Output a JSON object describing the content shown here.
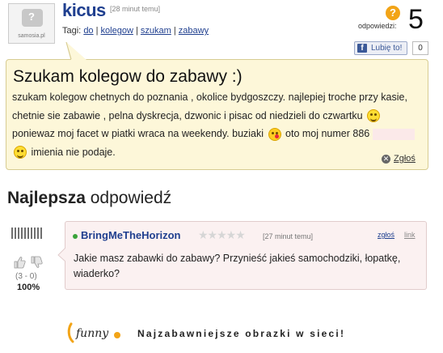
{
  "question": {
    "avatar_label": "samosia.pl",
    "username": "kicus",
    "time": "[28 minut temu]",
    "tags_label": "Tagi:",
    "tags": [
      "do",
      "kolegow",
      "szukam",
      "zabawy"
    ],
    "answers_label": "odpowiedzi:",
    "answers_count": "5",
    "like_label": "Lubię to!",
    "like_count": "0",
    "title": "Szukam kolegow do zabawy :)",
    "body_1": "szukam kolegow chetnych do poznania , okolice bydgoszczy. najlepiej troche przy kasie, chetnie sie zabawie , pelna dyskrecja, dzwonic i pisac od niedzieli do czwartku",
    "body_2": "poniewaz moj facet w piatki wraca na weekendy. buziaki",
    "body_3": "oto moj numer 886",
    "body_4": "imienia nie podaje.",
    "report_label": "Zgłoś"
  },
  "best_answer": {
    "heading_bold": "Najlepsza",
    "heading_rest": " odpowiedź",
    "username": "BringMeTheHorizon",
    "stars": "★★★★★",
    "time": "[27 minut temu]",
    "report_label": "zgłoś",
    "link_label": "link",
    "text": "Jakie masz zabawki do zabawy? Przynieść jakieś samochodziki, łopatkę, wiaderko?",
    "votes": "(3 - 0)",
    "percent": "100%"
  },
  "footer": {
    "logo_text": "funny",
    "slogan": "Najzabawniejsze obrazki w sieci!"
  },
  "colors": {
    "link_blue": "#1f3f8f",
    "question_bg": "#fdf7d9",
    "answer_bg": "#fbf1f1",
    "accent_orange": "#f2a417"
  }
}
